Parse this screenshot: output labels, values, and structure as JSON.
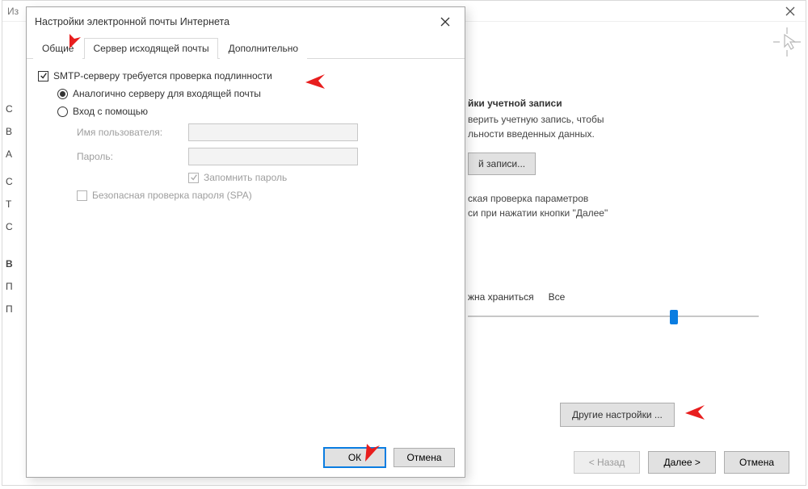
{
  "rear": {
    "header_text": "Из",
    "section_title": "йки учетной записи",
    "line1": "верить учетную запись, чтобы",
    "line2": "льности введенных данных.",
    "test_btn": "й записи...",
    "auto_line1": "ская проверка параметров",
    "auto_line2": "си при нажатии кнопки \"Далее\"",
    "offline_label": "жна храниться",
    "offline_value": "Все",
    "more_btn": "Другие настройки ...",
    "back": "< Назад",
    "next": "Далее >",
    "cancel": "Отмена",
    "truncated_letters": [
      "С",
      "В",
      "А",
      "С",
      "Т",
      "С",
      "В",
      "П",
      "П"
    ]
  },
  "dialog": {
    "title": "Настройки электронной почты Интернета",
    "tabs": {
      "general": "Общие",
      "outgoing": "Сервер исходящей почты",
      "advanced": "Дополнительно"
    },
    "smtp_auth": "SMTP-серверу требуется проверка подлинности",
    "same_as_incoming": "Аналогично серверу для входящей почты",
    "login_with": "Вход с помощью",
    "username": "Имя пользователя:",
    "password": "Пароль:",
    "remember": "Запомнить пароль",
    "spa": "Безопасная проверка пароля (SPA)",
    "ok": "ОК",
    "cancel": "Отмена"
  }
}
